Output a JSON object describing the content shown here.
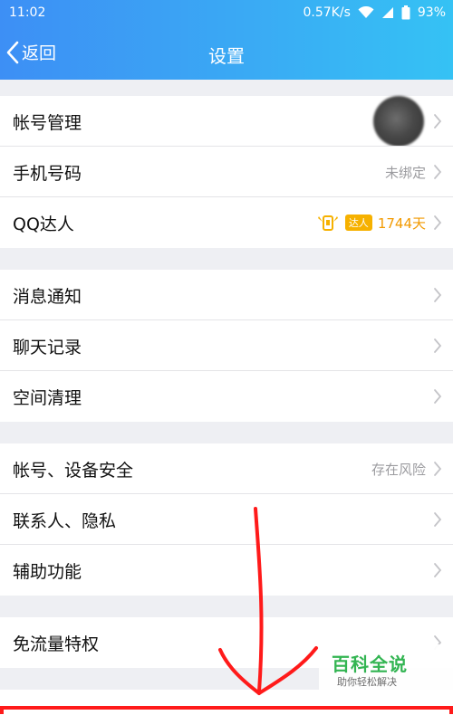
{
  "status": {
    "time": "11:02",
    "speed": "0.57K/s",
    "battery": "93%"
  },
  "nav": {
    "back_label": "返回",
    "title": "设置"
  },
  "groups": [
    {
      "items": [
        {
          "label": "帐号管理",
          "value": "",
          "type": "avatar"
        },
        {
          "label": "手机号码",
          "value": "未绑定",
          "type": "text"
        },
        {
          "label": "QQ达人",
          "value": "1744天",
          "type": "daren",
          "badge": "达人"
        }
      ]
    },
    {
      "items": [
        {
          "label": "消息通知",
          "value": ""
        },
        {
          "label": "聊天记录",
          "value": ""
        },
        {
          "label": "空间清理",
          "value": ""
        }
      ]
    },
    {
      "items": [
        {
          "label": "帐号、设备安全",
          "value": "存在风险"
        },
        {
          "label": "联系人、隐私",
          "value": ""
        },
        {
          "label": "辅助功能",
          "value": ""
        }
      ]
    },
    {
      "items": [
        {
          "label": "免流量特权",
          "value": ""
        }
      ]
    }
  ],
  "watermark": {
    "title": "百科全说",
    "subtitle": "助你轻松解决"
  },
  "colors": {
    "header_start": "#3d8ff5",
    "header_end": "#35c2f4",
    "annotation_red": "#ff1a1a",
    "daren_orange": "#f29a00",
    "watermark_green": "#2bb24c"
  },
  "icons": {
    "back": "chevron-left-icon",
    "row_arrow": "chevron-right-icon",
    "wifi": "wifi-icon",
    "signal": "signal-icon",
    "battery": "battery-icon",
    "daren": "daren-badge-icon"
  }
}
